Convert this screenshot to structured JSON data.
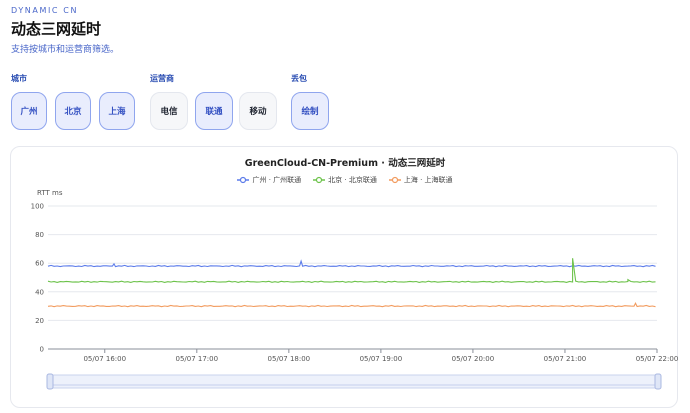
{
  "header": {
    "eyebrow": "DYNAMIC CN",
    "title": "动态三网延时",
    "subtitle": "支持按城市和运营商筛选。"
  },
  "filters": {
    "city": {
      "label": "城市",
      "options": [
        "广州",
        "北京",
        "上海"
      ],
      "active": [
        true,
        true,
        true
      ]
    },
    "carrier": {
      "label": "运营商",
      "options": [
        "电信",
        "联通",
        "移动"
      ],
      "active": [
        false,
        true,
        false
      ]
    },
    "color": {
      "label": "丢包",
      "options": [
        "绘制"
      ],
      "active": [
        true
      ]
    }
  },
  "chart_data": {
    "type": "line",
    "title": "GreenCloud-CN-Premium · 动态三网延时",
    "ylabel": "RTT ms",
    "xlabel": "",
    "ylim": [
      0,
      100
    ],
    "yticks": [
      0,
      20,
      40,
      60,
      80,
      100
    ],
    "xlim": [
      "05/07 15:23",
      "05/07 22:00"
    ],
    "xticks": [
      "05/07 16:00",
      "05/07 17:00",
      "05/07 18:00",
      "05/07 19:00",
      "05/07 20:00",
      "05/07 21:00",
      "05/07 22:00"
    ],
    "grid": true,
    "legend_position": "top-center",
    "series": [
      {
        "name": "广州 · 广州联通",
        "color": "#5b7bea",
        "base": 58,
        "spikes": [
          [
            "05/07 18:08",
            61.5
          ],
          [
            "05/07 16:06",
            59.5
          ]
        ]
      },
      {
        "name": "北京 · 北京联通",
        "color": "#6cc24a",
        "base": 47,
        "spikes": [
          [
            "05/07 21:05",
            63.5
          ],
          [
            "05/07 21:41",
            48.5
          ]
        ]
      },
      {
        "name": "上海 · 上海联通",
        "color": "#f29b5e",
        "base": 30,
        "spikes": [
          [
            "05/07 21:46",
            32
          ]
        ]
      }
    ]
  },
  "zoom_slider": {
    "start_percent": 0,
    "end_percent": 100
  }
}
